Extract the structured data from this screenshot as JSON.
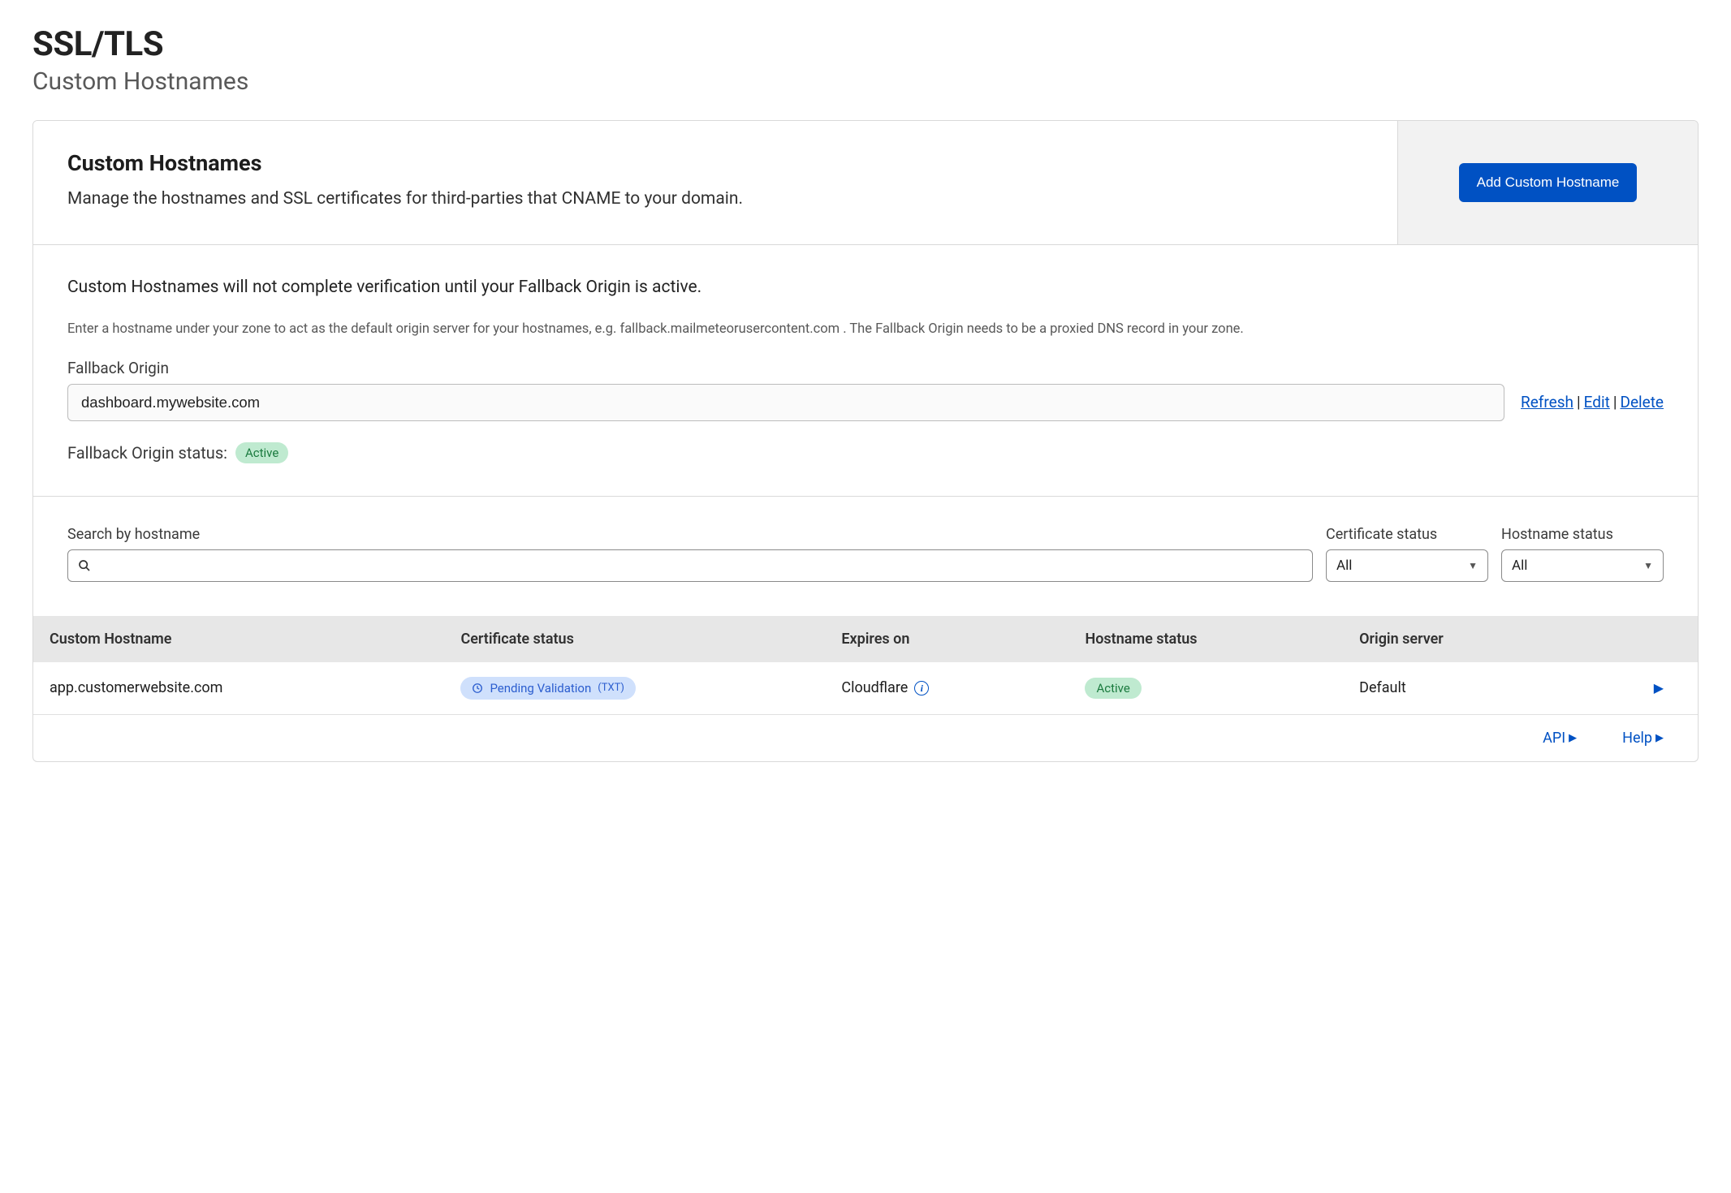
{
  "page": {
    "title": "SSL/TLS",
    "subtitle": "Custom Hostnames"
  },
  "header": {
    "title": "Custom Hostnames",
    "description": "Manage the hostnames and SSL certificates for third-parties that CNAME to your domain.",
    "add_button": "Add Custom Hostname"
  },
  "fallback": {
    "warning": "Custom Hostnames will not complete verification until your Fallback Origin is active.",
    "help": "Enter a hostname under your zone to act as the default origin server for your hostnames, e.g. fallback.mailmeteorusercontent.com . The Fallback Origin needs to be a proxied DNS record in your zone.",
    "label": "Fallback Origin",
    "value": "dashboard.mywebsite.com",
    "links": {
      "refresh": "Refresh",
      "edit": "Edit",
      "delete": "Delete"
    },
    "status_label": "Fallback Origin status:",
    "status_badge": "Active"
  },
  "filters": {
    "search_label": "Search by hostname",
    "search_placeholder": "",
    "cert_label": "Certificate status",
    "cert_value": "All",
    "host_label": "Hostname status",
    "host_value": "All"
  },
  "table": {
    "columns": {
      "hostname": "Custom Hostname",
      "cert_status": "Certificate status",
      "expires": "Expires on",
      "host_status": "Hostname status",
      "origin": "Origin server"
    },
    "rows": [
      {
        "hostname": "app.customerwebsite.com",
        "cert_status": "Pending Validation",
        "cert_status_suffix": "(TXT)",
        "expires": "Cloudflare",
        "host_status": "Active",
        "origin": "Default"
      }
    ]
  },
  "footer": {
    "api": "API",
    "help": "Help"
  }
}
